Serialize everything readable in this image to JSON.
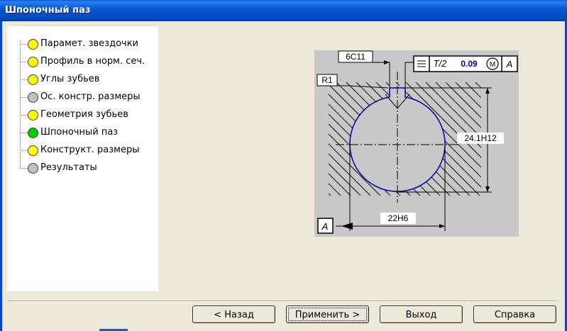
{
  "window": {
    "title": "Шпоночный паз"
  },
  "tree": {
    "items": [
      {
        "label": "Парамет. звездочки",
        "status_color": "#ffff00"
      },
      {
        "label": "Профиль в норм. сеч.",
        "status_color": "#ffff00"
      },
      {
        "label": "Углы зубьев",
        "status_color": "#ffff00"
      },
      {
        "label": "Ос. констр. размеры",
        "status_color": "#c0c0c0"
      },
      {
        "label": "Геометрия зубьев",
        "status_color": "#ffff00"
      },
      {
        "label": "Шпоночный паз",
        "status_color": "#00cc00"
      },
      {
        "label": "Конструкт. размеры",
        "status_color": "#ffff00"
      },
      {
        "label": "Результаты",
        "status_color": "#c0c0c0"
      }
    ]
  },
  "diagram": {
    "dim_width_label": "6C11",
    "radius_label": "R1",
    "tolerance_value": "0.09",
    "tolerance_t": "T/2",
    "tolerance_modifier": "M",
    "tolerance_datum": "A",
    "dim_depth_label": "24.1H12",
    "dim_diameter_label": "22H6",
    "datum_label": "A",
    "accent_color": "#0000aa"
  },
  "buttons": {
    "back": "< Назад",
    "apply": "Применить >",
    "exit": "Выход",
    "help": "Справка"
  }
}
